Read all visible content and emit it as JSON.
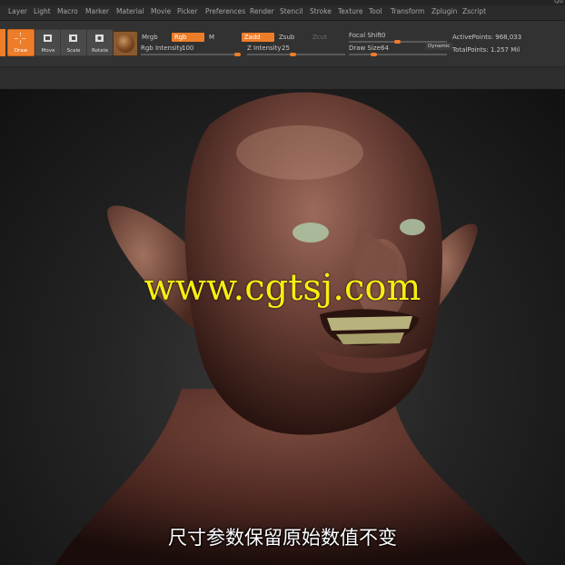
{
  "window": {
    "corner_label": "Qu"
  },
  "menu": {
    "items": [
      "Layer",
      "Light",
      "Macro",
      "Marker",
      "Material",
      "Movie",
      "Picker",
      "Preferences",
      "Render",
      "Stencil",
      "Stroke",
      "Texture",
      "Tool",
      "Transform",
      "Zplugin",
      "Zscript"
    ]
  },
  "toolbar": {
    "buttons": [
      {
        "label": "Draw",
        "icon": "draw-crosshair-icon",
        "active": true
      },
      {
        "label": "Move",
        "icon": "move-icon",
        "active": false
      },
      {
        "label": "Scale",
        "icon": "scale-icon",
        "active": false
      },
      {
        "label": "Rotate",
        "icon": "rotate-icon",
        "active": false
      }
    ],
    "material_icon": "material-sphere-icon",
    "mrgb": "Mrgb",
    "rgb": "Rgb",
    "m": "M",
    "zadd": "Zadd",
    "zsub": "Zsub",
    "zcut": "Zcut",
    "rgb_intensity": {
      "label": "Rgb Intensity",
      "value": "100"
    },
    "z_intensity": {
      "label": "Z Intensity",
      "value": "25"
    },
    "focal_shift": {
      "label": "Focal Shift",
      "value": "0"
    },
    "draw_size": {
      "label": "Draw Size",
      "value": "64"
    },
    "dynamic": "Dynamic",
    "active_points": "ActivePoints: 968,033",
    "total_points": "TotalPoints: 1.257 Mil"
  },
  "overlay": {
    "watermark": "www.cgtsj.com",
    "subtitle": "尺寸参数保留原始数值不变"
  },
  "colors": {
    "accent": "#ee7d2a",
    "watermark": "#f8ee10",
    "background": "#1a1a1a"
  }
}
